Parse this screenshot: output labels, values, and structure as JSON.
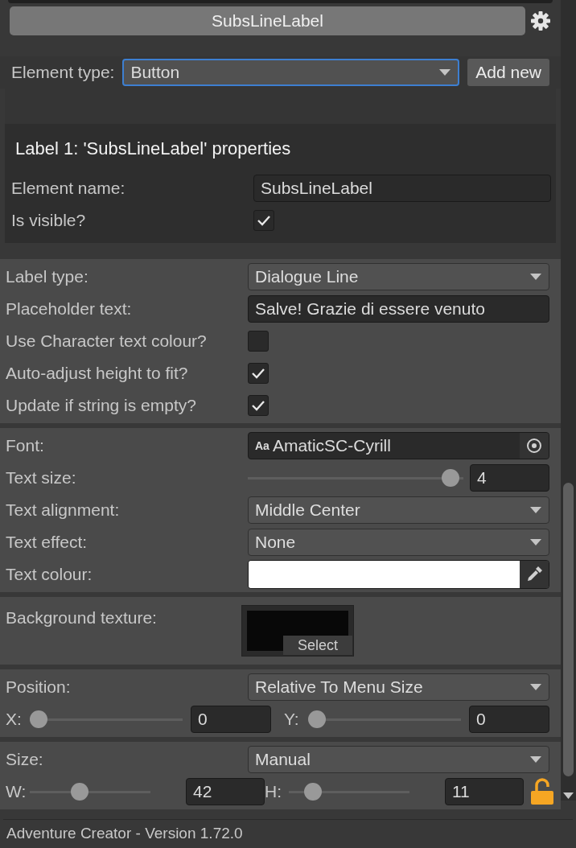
{
  "header": {
    "button": "SubsLineLabel"
  },
  "element_type": {
    "label": "Element type:",
    "value": "Button",
    "focused": true,
    "add_button": "Add new"
  },
  "properties": {
    "title": "Label 1: 'SubsLineLabel' properties",
    "rows": [
      {
        "kind": "text",
        "label": "Element name:",
        "value": "SubsLineLabel"
      },
      {
        "kind": "checkbox",
        "label": "Is visible?",
        "checked": true
      }
    ]
  },
  "sections": [
    {
      "rows": [
        {
          "kind": "dropdown",
          "label": "Label type:",
          "value": "Dialogue Line"
        },
        {
          "kind": "text",
          "label": "Placeholder text:",
          "value": "Salve! Grazie di essere venuto"
        },
        {
          "kind": "checkbox",
          "label": "Use Character text colour?",
          "checked": false
        },
        {
          "kind": "checkbox",
          "label": "Auto-adjust height to fit?",
          "checked": true
        },
        {
          "kind": "checkbox",
          "label": "Update if string is empty?",
          "checked": true
        }
      ]
    },
    {
      "rows": [
        {
          "kind": "object",
          "label": "Font:",
          "badge": "Aa",
          "value": "AmaticSC-Cyrill"
        },
        {
          "kind": "slider",
          "label": "Text size:",
          "level": 0.98,
          "value": "4"
        },
        {
          "kind": "dropdown",
          "label": "Text alignment:",
          "value": "Middle Center"
        },
        {
          "kind": "dropdown",
          "label": "Text effect:",
          "value": "None"
        },
        {
          "kind": "color",
          "label": "Text colour:",
          "color": "#ffffff"
        }
      ]
    },
    {
      "rows": [
        {
          "kind": "texture",
          "label": "Background texture:",
          "button": "Select"
        }
      ]
    },
    {
      "rows": [
        {
          "kind": "dropdown",
          "label": "Position:",
          "value": "Relative To Menu Size"
        },
        {
          "kind": "pair",
          "items": [
            {
              "label": "X:",
              "level": 0.0,
              "value": "0"
            },
            {
              "label": "Y:",
              "level": 0.0,
              "value": "0"
            }
          ]
        }
      ]
    },
    {
      "rows": [
        {
          "kind": "dropdown",
          "label": "Size:",
          "value": "Manual"
        },
        {
          "kind": "pair",
          "lock": true,
          "items": [
            {
              "label": "W:",
              "level": 0.4,
              "value": "42"
            },
            {
              "label": "H:",
              "level": 0.15,
              "value": "11"
            }
          ]
        }
      ]
    }
  ],
  "footer": "Adventure Creator - Version 1.72.0"
}
